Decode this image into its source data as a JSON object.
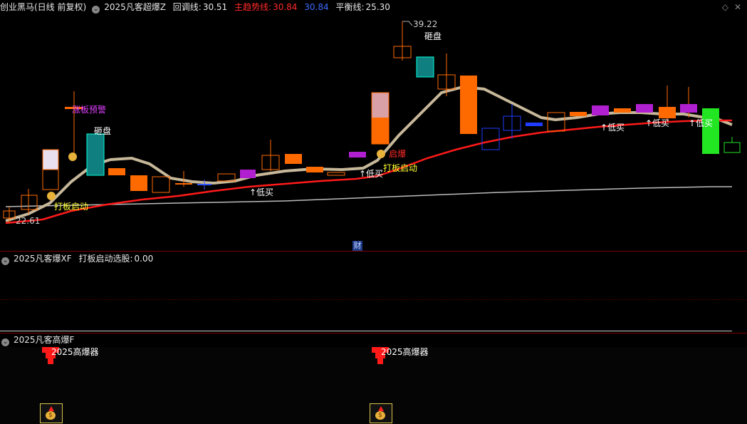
{
  "header": {
    "stock_name": "创业黑马(日线 前复权)",
    "indicator_name": "2025凡客超爆Z",
    "pullback_label": "回调线:",
    "pullback_value": "30.51",
    "main_trend_label": "主趋势线:",
    "main_trend_value": "30.84",
    "blue_value": "30.84",
    "balance_label": "平衡线:",
    "balance_value": "25.30"
  },
  "main_chart": {
    "high_label": "39.22",
    "low_label": "22.61",
    "annotations": {
      "warning": "涨板预警",
      "smash1": "砸盘",
      "smash2": "砸盘",
      "launch1": "打板启动",
      "launch2": "打板启动",
      "explode": "启爆",
      "buy_low_1": "↑低买",
      "buy_low_2": "↑低买",
      "buy_low_3": "↑低买",
      "buy_low_4": "↑低买",
      "buy_low_5": "↑低买"
    },
    "cai_label": "财"
  },
  "pane2": {
    "indicator_name": "2025凡客爆XF",
    "field_label": "打板启动选股:",
    "field_value": "0.00"
  },
  "pane3": {
    "indicator_name": "2025凡客高爆F",
    "signal_1": "2025高爆器",
    "signal_2": "2025高爆器"
  },
  "colors": {
    "up": "#ff6a00",
    "down_blue": "#1f3cff",
    "main_trend": "#ff1a1a",
    "pullback": "#c7b89a",
    "balance": "#bbbbbb"
  }
}
